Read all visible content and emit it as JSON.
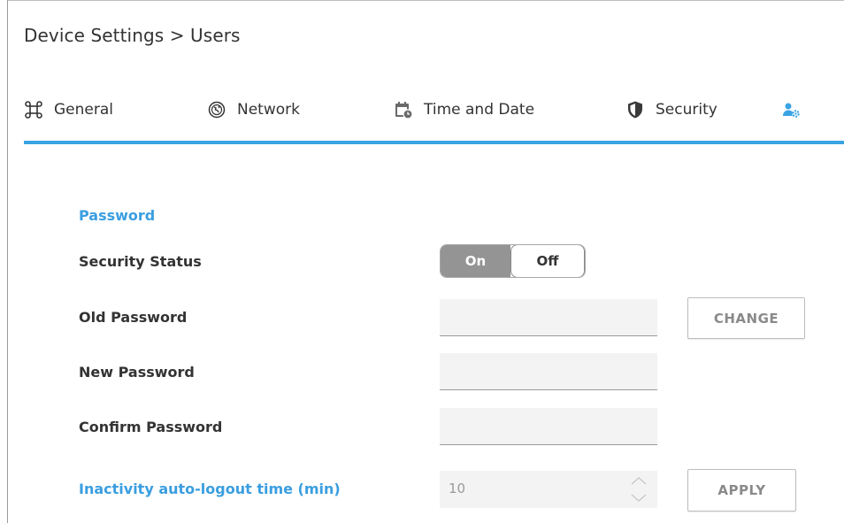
{
  "breadcrumb": "Device Settings > Users",
  "tabs": [
    {
      "label": "General",
      "icon": "command-icon"
    },
    {
      "label": "Network",
      "icon": "globe-icon"
    },
    {
      "label": "Time and Date",
      "icon": "calendar-clock-icon"
    },
    {
      "label": "Security",
      "icon": "shield-icon"
    },
    {
      "label": "Users",
      "icon": "users-gear-icon",
      "active": true
    }
  ],
  "password": {
    "section_title": "Password",
    "security_status_label": "Security Status",
    "toggle_on": "On",
    "toggle_off": "Off",
    "toggle_selected": "Off",
    "old_password_label": "Old Password",
    "old_password_value": "",
    "new_password_label": "New Password",
    "new_password_value": "",
    "confirm_password_label": "Confirm Password",
    "confirm_password_value": "",
    "change_button": "CHANGE"
  },
  "logout": {
    "label": "Inactivity auto-logout time (min)",
    "value": "10",
    "apply_button": "APPLY"
  },
  "colors": {
    "accent": "#3aa3e3",
    "label_blue": "#3a9ee0",
    "toggle_on_bg": "#949494",
    "field_bg": "#f3f3f3"
  }
}
